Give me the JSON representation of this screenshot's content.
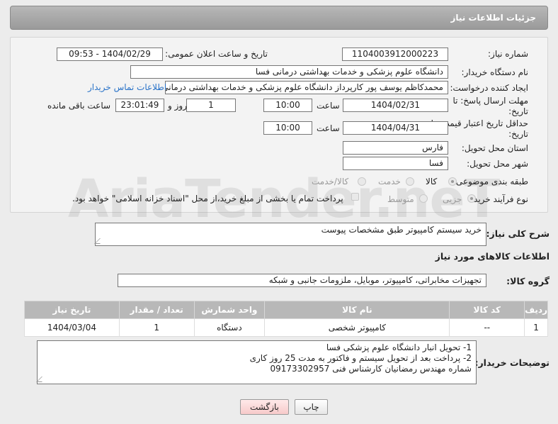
{
  "header": {
    "title": "جزئیات اطلاعات نیاز"
  },
  "fields": {
    "need_number_label": "شماره نیاز:",
    "need_number": "1104003912000223",
    "announce_label": "تاریخ و ساعت اعلان عمومی:",
    "announce_value": "1404/02/29 - 09:53",
    "buyer_org_label": "نام دستگاه خریدار:",
    "buyer_org": "دانشگاه علوم پزشکی و خدمات بهداشتی درمانی فسا",
    "requester_label": "ایجاد کننده درخواست:",
    "requester": "محمدکاظم یوسف پور کارپرداز دانشگاه علوم پزشکی و خدمات بهداشتی درمانی فسا",
    "buyer_contact_link": "اطلاعات تماس خریدار",
    "deadline_label": "مهلت ارسال پاسخ: تا تاریخ:",
    "deadline_date": "1404/02/31",
    "time_label": "ساعت",
    "deadline_time": "10:00",
    "days_value": "1",
    "days_label": "روز و",
    "remaining_value": "23:01:49",
    "remaining_label": "ساعت باقی مانده",
    "price_validity_label": "حداقل تاریخ اعتبار قیمت: تا تاریخ:",
    "price_validity_date": "1404/04/31",
    "price_validity_time": "10:00",
    "province_label": "استان محل تحویل:",
    "province": "فارس",
    "city_label": "شهر محل تحویل:",
    "city": "فسا",
    "category_label": "طبقه بندی موضوعی:",
    "category_options": [
      "کالا",
      "خدمت",
      "کالا/خدمت"
    ],
    "process_label": "نوع فرآیند خرید :",
    "process_options": [
      "جزیی",
      "متوسط"
    ],
    "payment_note": "پرداخت تمام یا بخشی از مبلغ خرید،از محل \"اسناد خزانه اسلامی\" خواهد بود."
  },
  "summary": {
    "label": "شرح کلی نیاز:",
    "text": "خرید سیستم کامپیوتر طبق مشخصات پیوست"
  },
  "goods_section": {
    "title": "اطلاعات کالاهای مورد نیاز",
    "group_label": "گروه کالا:",
    "group_value": "تجهیزات مخابراتی، کامپیوتر، موبایل، ملزومات جانبی و شبکه",
    "columns": [
      "ردیف",
      "کد کالا",
      "نام کالا",
      "واحد شمارش",
      "تعداد / مقدار",
      "تاریخ نیاز"
    ],
    "rows": [
      [
        "1",
        "--",
        "کامپیوتر شخصی",
        "دستگاه",
        "1",
        "1404/03/04"
      ]
    ]
  },
  "buyer_notes": {
    "label": "توضیحات خریدار:",
    "lines": [
      "1- تحویل انبار دانشگاه علوم پزشکی فسا",
      "2- پرداخت بعد از تحویل سیستم و فاکتور به مدت 25 روز کاری",
      "شماره مهندس رمضانیان کارشناس فنی 09173302957"
    ]
  },
  "buttons": {
    "print": "چاپ",
    "back": "بازگشت"
  },
  "watermark": "AriaTender.neT"
}
